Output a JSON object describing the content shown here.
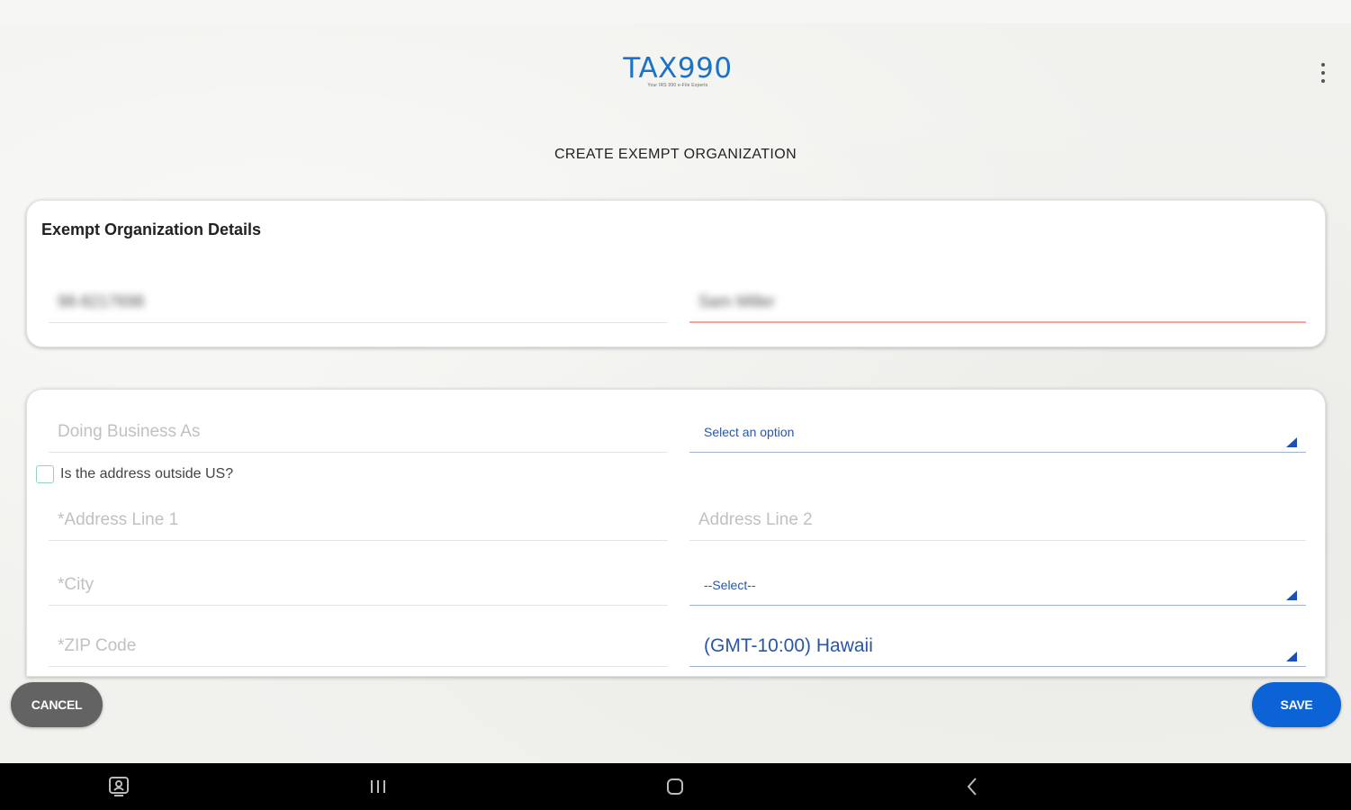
{
  "logo": {
    "text": "TAX990",
    "tagline": "Your IRS 990 e-File Experts"
  },
  "page": {
    "title": "CREATE EXEMPT ORGANIZATION"
  },
  "details_card": {
    "title": "Exempt Organization Details",
    "ein_value": "98-8217698",
    "name_value": "Sam Miller"
  },
  "address_card": {
    "dba_placeholder": "Doing Business As",
    "org_type_select": "Select an option",
    "outside_us_label": "Is the address outside US?",
    "address1_placeholder": "*Address Line 1",
    "address2_placeholder": "Address Line 2",
    "city_placeholder": "*City",
    "state_select": "--Select--",
    "zip_placeholder": "*ZIP Code",
    "timezone_select": "(GMT-10:00) Hawaii"
  },
  "actions": {
    "cancel_label": "CANCEL",
    "save_label": "SAVE"
  },
  "icons": {
    "menu": "kebab-menu-icon",
    "nav": [
      "screenshot-icon",
      "recents-icon",
      "home-icon",
      "back-icon"
    ]
  },
  "colors": {
    "brand": "#1a73c9",
    "save": "#0b63d6",
    "cancel": "#636363",
    "error_underline": "#f0a795",
    "select_text": "#2a56a8"
  }
}
